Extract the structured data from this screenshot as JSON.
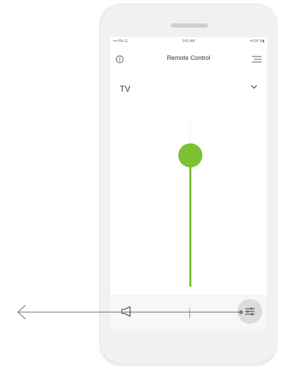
{
  "status_bar": {
    "carrier": "•••• Blu ☰",
    "time": "9:41 AM",
    "battery": "≑100 %▮"
  },
  "header": {
    "title": "Remote Control"
  },
  "source": {
    "selected": "TV"
  },
  "slider": {
    "level": 1.0
  },
  "icons": {
    "info": "info-icon",
    "menu": "menu-icon",
    "dropdown": "chevron-down-icon",
    "mute": "speaker-mute-icon",
    "settings": "sliders-icon"
  },
  "colors": {
    "accent": "#7ac231",
    "button_bg": "#dcdcdc",
    "callout": "#555555"
  }
}
